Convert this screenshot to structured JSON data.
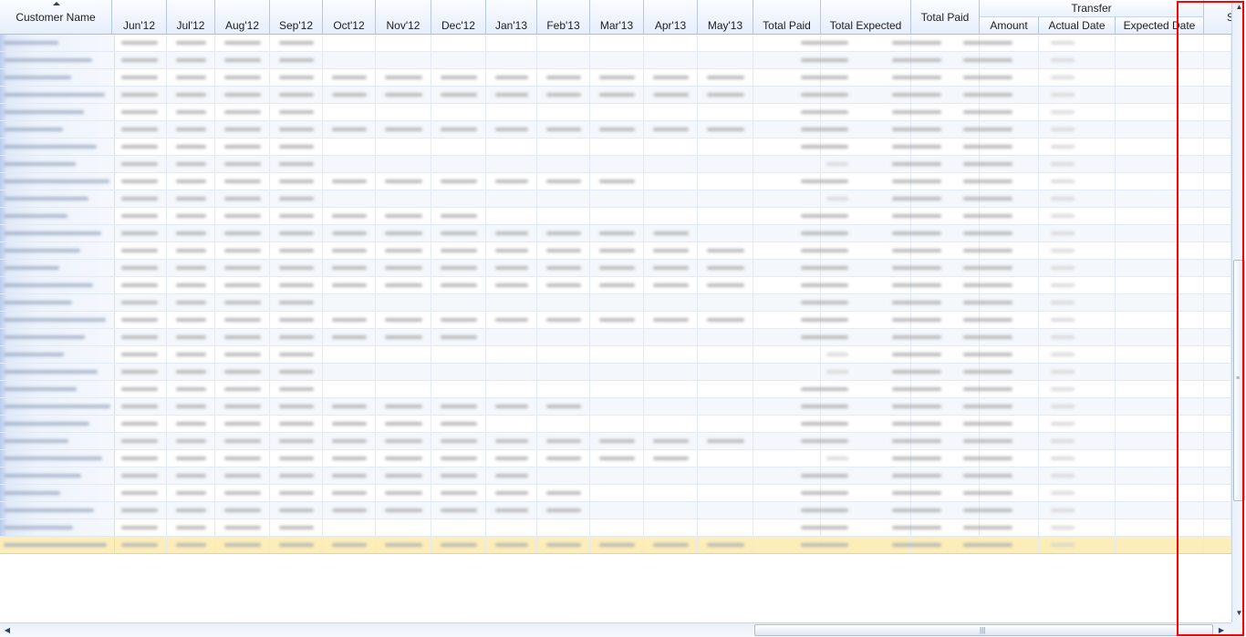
{
  "grid": {
    "name_column": {
      "label": "Customer Name",
      "sorted": "ascending"
    },
    "month_columns": [
      {
        "key": "jun12",
        "label": "Jun'12"
      },
      {
        "key": "jul12",
        "label": "Jul'12"
      },
      {
        "key": "aug12",
        "label": "Aug'12"
      },
      {
        "key": "sep12",
        "label": "Sep'12"
      },
      {
        "key": "oct12",
        "label": "Oct'12"
      },
      {
        "key": "nov12",
        "label": "Nov'12"
      },
      {
        "key": "dec12",
        "label": "Dec'12"
      },
      {
        "key": "jan13",
        "label": "Jan'13"
      },
      {
        "key": "feb13",
        "label": "Feb'13"
      },
      {
        "key": "mar13",
        "label": "Mar'13"
      },
      {
        "key": "apr13",
        "label": "Apr'13"
      },
      {
        "key": "may13",
        "label": "May'13"
      }
    ],
    "total_paid_label": "Total Paid",
    "total_expected_label": "Total Expected",
    "total_paid_group_label": "Total Paid",
    "transfer": {
      "label": "Transfer",
      "columns": [
        "Amount",
        "Actual Date",
        "Expected Date"
      ]
    },
    "clipped_next_column": "S",
    "row_month_fill": [
      4,
      4,
      12,
      12,
      4,
      13,
      4,
      4,
      10,
      4,
      7,
      11,
      12,
      12,
      13,
      4,
      12,
      7,
      4,
      4,
      4,
      9,
      7,
      13,
      11,
      8,
      9,
      9,
      4,
      12
    ],
    "row_total_paid_light": [
      false,
      false,
      false,
      false,
      false,
      false,
      false,
      true,
      false,
      true,
      false,
      false,
      false,
      false,
      false,
      false,
      false,
      false,
      true,
      true,
      false,
      false,
      false,
      false,
      true,
      false,
      false,
      false,
      false,
      false
    ],
    "hover_row": 29,
    "selected_row": 30
  },
  "colors": {
    "highlight_outline": "#ff0000",
    "selection": "#f9c566",
    "header_gradient_bottom": "#e6eefa"
  },
  "icons": {
    "sort": "sort-ascending-icon",
    "scroll_up": "arrow-up-icon",
    "scroll_down": "arrow-down-icon",
    "scroll_left": "arrow-left-icon",
    "scroll_right": "arrow-right-icon"
  }
}
